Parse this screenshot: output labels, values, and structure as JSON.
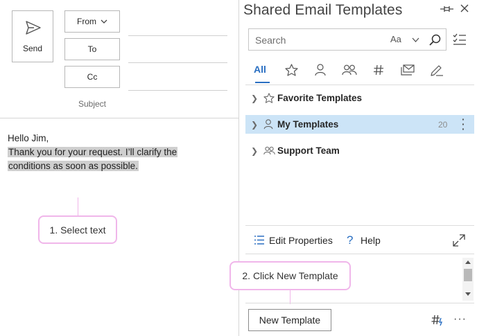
{
  "compose": {
    "send_label": "Send",
    "from_label": "From",
    "to_label": "To",
    "cc_label": "Cc",
    "subject_label": "Subject",
    "body_greeting": "Hello Jim,",
    "body_line1": "Thank you for your request. I’ll clarify the",
    "body_line2": "conditions as soon as possible."
  },
  "callouts": {
    "step1": "1. Select text",
    "step2": "2. Click New Template"
  },
  "pane": {
    "title": "Shared Email Templates",
    "search_placeholder": "Search",
    "match_case_label": "Aa",
    "tabs": [
      {
        "label": "All",
        "icon": "all",
        "active": true
      },
      {
        "label": "",
        "icon": "star-icon"
      },
      {
        "label": "",
        "icon": "person-icon"
      },
      {
        "label": "",
        "icon": "people-icon"
      },
      {
        "label": "",
        "icon": "hash-icon"
      },
      {
        "label": "",
        "icon": "envelope-icon"
      },
      {
        "label": "",
        "icon": "pen-icon"
      }
    ],
    "folders": [
      {
        "label": "Favorite Templates",
        "icon": "star-icon",
        "count": "",
        "selected": false
      },
      {
        "label": "My Templates",
        "icon": "person-icon",
        "count": "20",
        "selected": true
      },
      {
        "label": "Support Team",
        "icon": "people-icon",
        "count": "",
        "selected": false
      }
    ],
    "edit_properties_label": "Edit Properties",
    "help_label": "Help",
    "new_template_label": "New Template"
  },
  "colors": {
    "accent": "#2a6fc2",
    "selection": "#cce4f7",
    "callout_border": "#f0b6ea",
    "text_highlight": "#cfcfcf"
  }
}
